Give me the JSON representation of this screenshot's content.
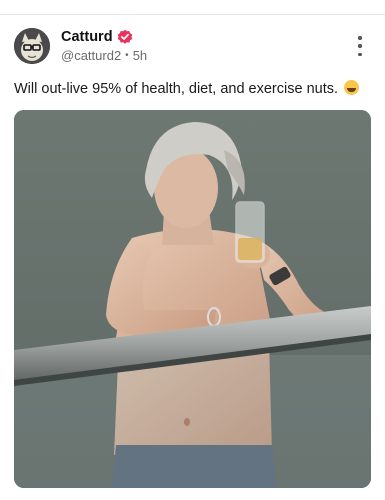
{
  "post": {
    "author_name": "Catturd",
    "handle": "@catturd2",
    "separator": "•",
    "time": "5h",
    "text": "Will out-live 95% of health, diet, and exercise nuts.",
    "emoji_icon": "laughing-emoji-icon"
  },
  "colors": {
    "verified": "#e8335e",
    "background": "#ffffff",
    "muted": "#6b6b6b"
  },
  "image": {
    "subject": "photo"
  }
}
